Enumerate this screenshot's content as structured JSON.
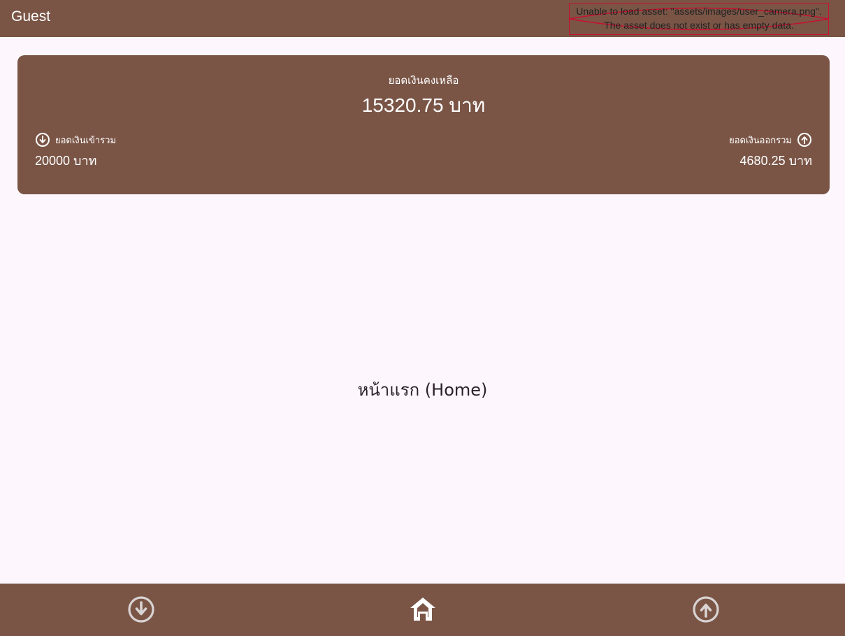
{
  "appbar": {
    "title": "Guest",
    "avatar_error_line1": "Unable to load asset: \"assets/images/user_camera.png\".",
    "avatar_error_line2": "The asset does not exist or has empty data."
  },
  "summary": {
    "balance_label": "ยอดเงินคงเหลือ",
    "balance_value": "15320.75 บาท",
    "income_label": "ยอดเงินเข้ารวม",
    "income_value": "20000 บาท",
    "expense_label": "ยอดเงินออกรวม",
    "expense_value": "4680.25 บาท"
  },
  "main": {
    "page_text": "หน้าแรก (Home)"
  },
  "icons": {
    "income": "arrow-down-circle-icon",
    "expense": "arrow-up-circle-icon",
    "home": "home-icon"
  },
  "bottom_nav": {
    "items": [
      {
        "name": "income",
        "icon": "arrow-down-circle-icon",
        "selected": false
      },
      {
        "name": "home",
        "icon": "home-icon",
        "selected": true
      },
      {
        "name": "expense",
        "icon": "arrow-up-circle-icon",
        "selected": false
      }
    ]
  },
  "colors": {
    "primary": "#7a5546",
    "background": "#fdf7fd",
    "on_primary": "#ffffff",
    "nav_inactive": "#d9d3d3",
    "error_cross": "#c8102e"
  }
}
